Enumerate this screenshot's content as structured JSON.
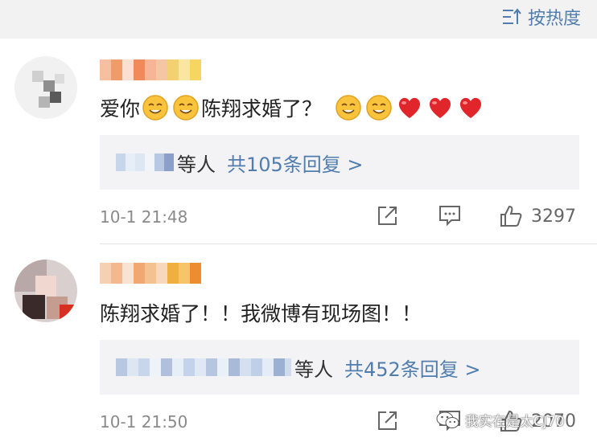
{
  "header": {
    "sort_label": "按热度",
    "sort_icon": "sort-lines-icon"
  },
  "comments": [
    {
      "text_parts": [
        "爱你",
        "陈翔求婚了？"
      ],
      "emojis": [
        "smile-emoji",
        "smile-emoji",
        "smile-emoji",
        "smile-emoji",
        "heart-emoji",
        "heart-emoji",
        "heart-emoji"
      ],
      "reply_suffix": "等人",
      "reply_link": "共105条回复 >",
      "time": "10-1 21:48",
      "like_count": "3297"
    },
    {
      "text": "陈翔求婚了！！我微博有现场图！！",
      "reply_suffix": "等人",
      "reply_link": "共452条回复 >",
      "time": "10-1 21:50",
      "like_count": "2070"
    }
  ],
  "watermark": {
    "text": "我实在是太CJ70",
    "icon": "wechat-icon"
  },
  "colors": {
    "link": "#507daf",
    "heart": "#e0252b",
    "header_bg": "#f2f2f2",
    "reply_bg": "#f3f3f5"
  }
}
